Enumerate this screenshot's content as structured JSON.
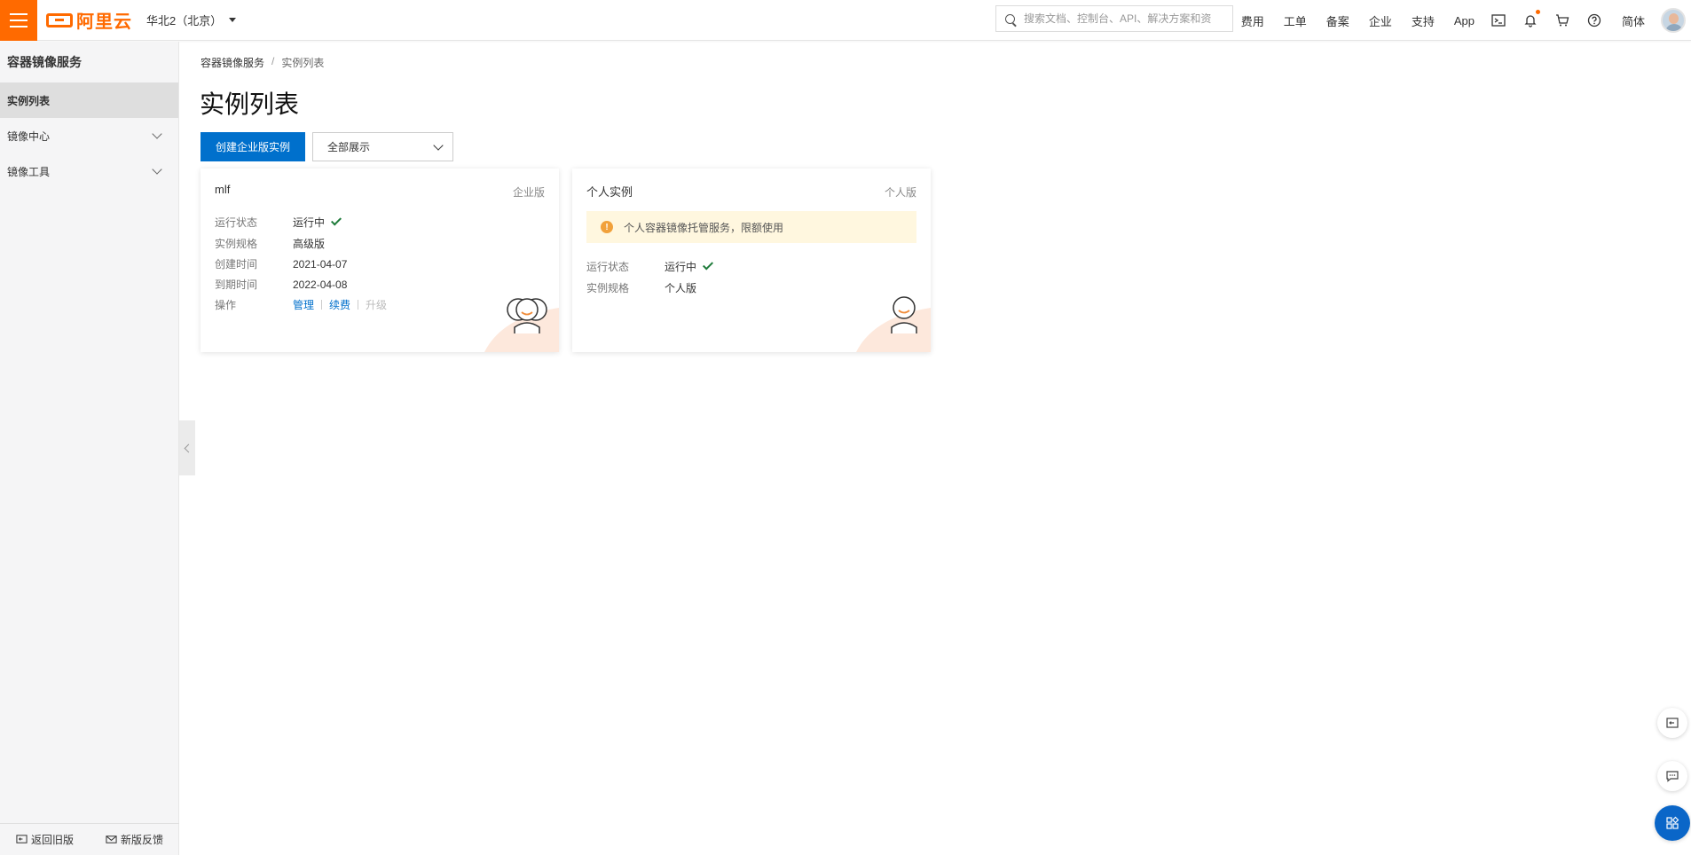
{
  "topbar": {
    "logo_text": "阿里云",
    "region": "华北2（北京）",
    "search_placeholder": "搜索文档、控制台、API、解决方案和资",
    "links": [
      "费用",
      "工单",
      "备案",
      "企业",
      "支持",
      "App"
    ],
    "lang": "简体",
    "brand_color": "#ff6a00"
  },
  "sidebar": {
    "title": "容器镜像服务",
    "items": [
      {
        "label": "实例列表",
        "active": true
      },
      {
        "label": "镜像中心",
        "expandable": true
      },
      {
        "label": "镜像工具",
        "expandable": true
      }
    ],
    "footer": {
      "back": "返回旧版",
      "feedback": "新版反馈"
    }
  },
  "main": {
    "breadcrumb": [
      "容器镜像服务",
      "/",
      "实例列表"
    ],
    "title": "实例列表",
    "create_button": "创建企业版实例",
    "filter_value": "全部展示",
    "primary_color": "#0070cc"
  },
  "cards": {
    "enterprise": {
      "name": "mlf",
      "tag": "企业版",
      "rows": {
        "status_label": "运行状态",
        "status_value": "运行中",
        "spec_label": "实例规格",
        "spec_value": "高级版",
        "created_label": "创建时间",
        "created_value": "2021-04-07",
        "expire_label": "到期时间",
        "expire_value": "2022-04-08",
        "ops_label": "操作"
      },
      "ops": {
        "manage": "管理",
        "renew": "续费",
        "upgrade": "升级"
      }
    },
    "personal": {
      "name": "个人实例",
      "tag": "个人版",
      "notice": "个人容器镜像托管服务，限额使用",
      "rows": {
        "status_label": "运行状态",
        "status_value": "运行中",
        "spec_label": "实例规格",
        "spec_value": "个人版"
      }
    }
  },
  "icons": [
    "menu-icon",
    "search-icon",
    "terminal-icon",
    "bell-icon",
    "cart-icon",
    "help-icon",
    "check-icon",
    "warning-icon",
    "chevron-down-icon"
  ]
}
